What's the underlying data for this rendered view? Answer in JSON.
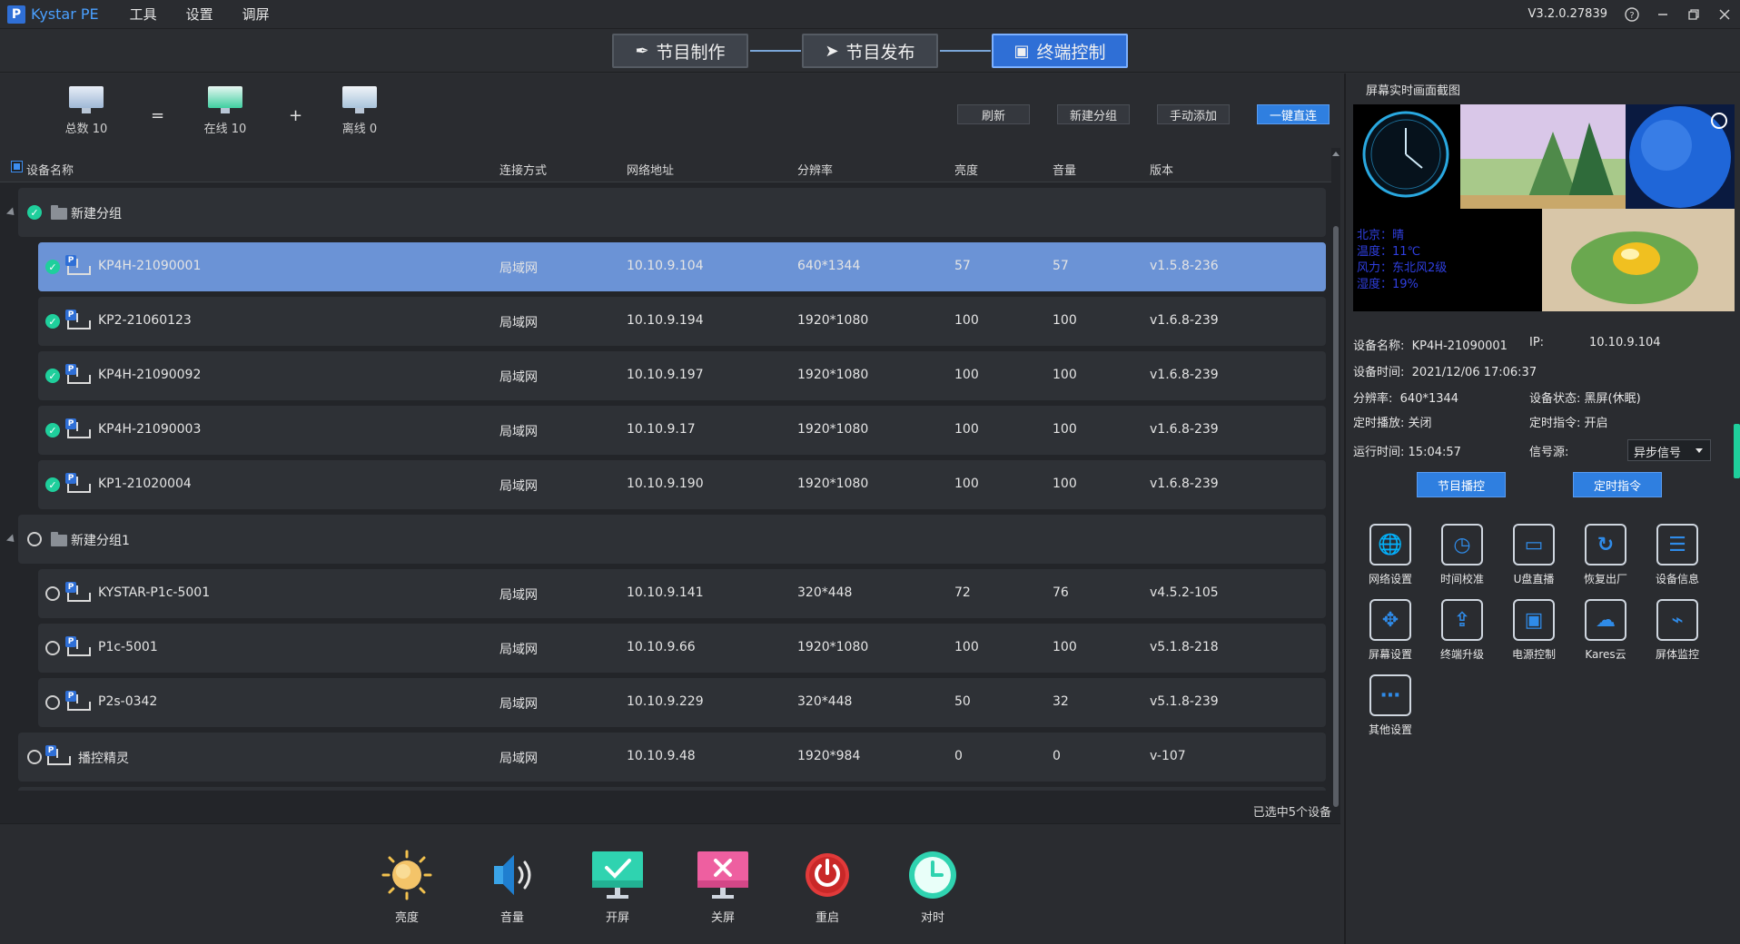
{
  "app": {
    "logo_letter": "P",
    "name": "Kystar PE",
    "version": "V3.2.0.27839"
  },
  "menu": [
    {
      "label": "工具"
    },
    {
      "label": "设置"
    },
    {
      "label": "调屏"
    }
  ],
  "steps": [
    {
      "label": "节目制作",
      "icon": "pen-icon"
    },
    {
      "label": "节目发布",
      "icon": "paper-plane-icon"
    },
    {
      "label": "终端控制",
      "icon": "monitor-icon",
      "active": true
    }
  ],
  "summary": {
    "total": "总数 10",
    "online": "在线 10",
    "offline": "离线 0",
    "op_eq": "=",
    "op_plus": "+"
  },
  "top_buttons": {
    "refresh": "刷新",
    "new_group": "新建分组",
    "manual_add": "手动添加",
    "direct_connect": "一键直连"
  },
  "table": {
    "headers": [
      "设备名称",
      "连接方式",
      "网络地址",
      "分辨率",
      "亮度",
      "音量",
      "版本"
    ]
  },
  "groups": [
    {
      "name": "新建分组",
      "checked": true,
      "devices": [
        {
          "name": "KP4H-21090001",
          "conn": "局域网",
          "ip": "10.10.9.104",
          "res": "640*1344",
          "brightness": "57",
          "volume": "57",
          "version": "v1.5.8-236",
          "checked": true,
          "selected": true
        },
        {
          "name": "KP2-21060123",
          "conn": "局域网",
          "ip": "10.10.9.194",
          "res": "1920*1080",
          "brightness": "100",
          "volume": "100",
          "version": "v1.6.8-239",
          "checked": true
        },
        {
          "name": "KP4H-21090092",
          "conn": "局域网",
          "ip": "10.10.9.197",
          "res": "1920*1080",
          "brightness": "100",
          "volume": "100",
          "version": "v1.6.8-239",
          "checked": true
        },
        {
          "name": "KP4H-21090003",
          "conn": "局域网",
          "ip": "10.10.9.17",
          "res": "1920*1080",
          "brightness": "100",
          "volume": "100",
          "version": "v1.6.8-239",
          "checked": true
        },
        {
          "name": "KP1-21020004",
          "conn": "局域网",
          "ip": "10.10.9.190",
          "res": "1920*1080",
          "brightness": "100",
          "volume": "100",
          "version": "v1.6.8-239",
          "checked": true
        }
      ]
    },
    {
      "name": "新建分组1",
      "checked": false,
      "devices": [
        {
          "name": "KYSTAR-P1c-5001",
          "conn": "局域网",
          "ip": "10.10.9.141",
          "res": "320*448",
          "brightness": "72",
          "volume": "76",
          "version": "v4.5.2-105",
          "checked": false
        },
        {
          "name": "P1c-5001",
          "conn": "局域网",
          "ip": "10.10.9.66",
          "res": "1920*1080",
          "brightness": "100",
          "volume": "100",
          "version": "v5.1.8-218",
          "checked": false
        },
        {
          "name": "P2s-0342",
          "conn": "局域网",
          "ip": "10.10.9.229",
          "res": "320*448",
          "brightness": "50",
          "volume": "32",
          "version": "v5.1.8-239",
          "checked": false
        }
      ]
    }
  ],
  "ungrouped": [
    {
      "name": "播控精灵",
      "conn": "局域网",
      "ip": "10.10.9.48",
      "res": "1920*984",
      "brightness": "0",
      "volume": "0",
      "version": "v-107",
      "checked": false
    }
  ],
  "status": "已选中5个设备",
  "actions": [
    {
      "label": "亮度",
      "icon": "sun-icon"
    },
    {
      "label": "音量",
      "icon": "speaker-icon"
    },
    {
      "label": "开屏",
      "icon": "screen-on-icon"
    },
    {
      "label": "关屏",
      "icon": "screen-off-icon"
    },
    {
      "label": "重启",
      "icon": "power-icon"
    },
    {
      "label": "对时",
      "icon": "clock-icon"
    }
  ],
  "right": {
    "title": "屏幕实时画面截图",
    "weather": [
      "北京：晴",
      "温度：11℃",
      "风力：东北风2级",
      "湿度：19%"
    ],
    "info": {
      "name_k": "设备名称:",
      "name_v": "KP4H-21090001",
      "ip_k": "IP:",
      "ip_v": "10.10.9.104",
      "time_k": "设备时间:",
      "time_v": "2021/12/06 17:06:37",
      "res_k": "分辨率:",
      "res_v": "640*1344",
      "state_k": "设备状态:",
      "state_v": "黑屏(休眠)",
      "sched_play_k": "定时播放:",
      "sched_play_v": "关闭",
      "sched_cmd_k": "定时指令:",
      "sched_cmd_v": "开启",
      "run_k": "运行时间:",
      "run_v": "15:04:57",
      "signal_k": "信号源:",
      "signal_v": "异步信号"
    },
    "btn_program": "节目播控",
    "btn_schedule": "定时指令",
    "tools": [
      {
        "label": "网络设置",
        "icon": "globe-icon",
        "glyph": "🌐"
      },
      {
        "label": "时间校准",
        "icon": "clock-icon",
        "glyph": "◷"
      },
      {
        "label": "U盘直播",
        "icon": "usb-icon",
        "glyph": "▭"
      },
      {
        "label": "恢复出厂",
        "icon": "reset-icon",
        "glyph": "↻"
      },
      {
        "label": "设备信息",
        "icon": "list-icon",
        "glyph": "☰"
      },
      {
        "label": "屏幕设置",
        "icon": "move-icon",
        "glyph": "✥"
      },
      {
        "label": "终端升级",
        "icon": "upload-icon",
        "glyph": "⇪"
      },
      {
        "label": "电源控制",
        "icon": "chip-icon",
        "glyph": "▣"
      },
      {
        "label": "Kares云",
        "icon": "cloud-icon",
        "glyph": "☁"
      },
      {
        "label": "屏体监控",
        "icon": "monitor-chart-icon",
        "glyph": "⌁"
      },
      {
        "label": "其他设置",
        "icon": "more-icon",
        "glyph": "⋯"
      }
    ]
  },
  "colors": {
    "accent": "#2f7fe0",
    "online": "#1fcf9c",
    "selected_row": "#6b93d6"
  }
}
